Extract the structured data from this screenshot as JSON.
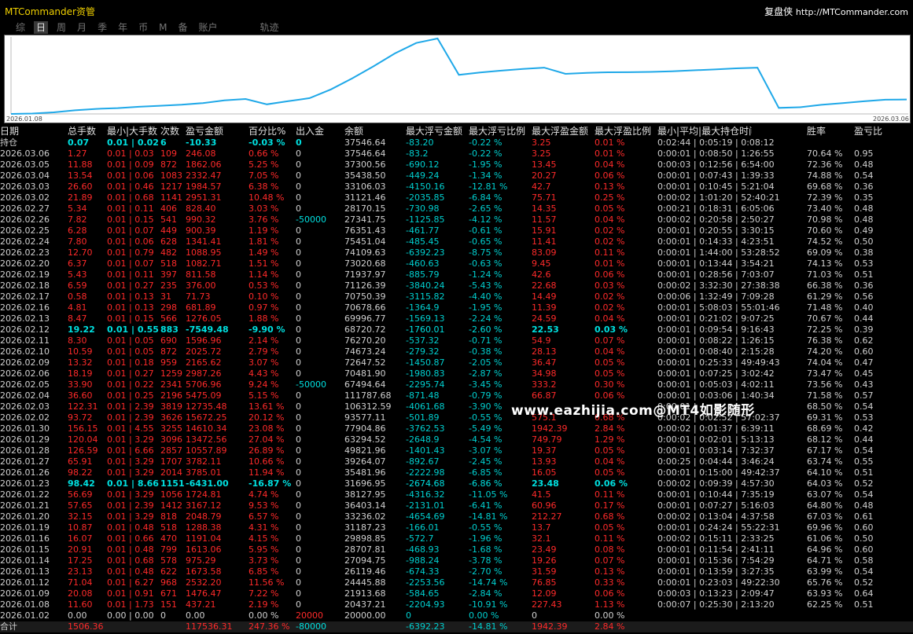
{
  "app": {
    "title": "MTCommander资管",
    "brand": "复盘侠",
    "url": "http://MTCommander.com"
  },
  "tabs": [
    {
      "label": "综",
      "active": false
    },
    {
      "label": "日",
      "active": true
    },
    {
      "label": "周",
      "active": false
    },
    {
      "label": "月",
      "active": false
    },
    {
      "label": "季",
      "active": false
    },
    {
      "label": "年",
      "active": false
    },
    {
      "label": "币",
      "active": false
    },
    {
      "label": "M",
      "active": false
    },
    {
      "label": "备",
      "active": false
    },
    {
      "label": "账户",
      "active": false
    },
    {
      "label": "轨迹",
      "active": false
    }
  ],
  "chart_data": {
    "type": "line",
    "x_start": "2026.01.08",
    "x_end": "2026.03.06",
    "series": [
      {
        "color": "#1fa8e8",
        "values": [
          20000,
          20437.21,
          21913.68,
          24445.88,
          26119.46,
          27094.75,
          28707.81,
          29898.85,
          31187.23,
          33236.02,
          36403.14,
          38127.95,
          31696.95,
          35481.96,
          39264.07,
          49821.96,
          63294.52,
          77904.86,
          93577.11,
          106312.59,
          111787.68,
          67494.64,
          70481.9,
          72647.52,
          74673.24,
          76270.2,
          68720.72,
          69996.77,
          70678.66,
          70750.39,
          71126.39,
          71937.97,
          73020.68,
          74109.63,
          75451.04,
          76351.43,
          27341.75,
          28170.15,
          31121.46,
          33106.03,
          35438.5,
          37300.56,
          37546.64
        ]
      }
    ]
  },
  "watermark": "www.eazhijia.com@MT4如影随形",
  "table": {
    "headers": [
      "日期",
      "总手数",
      "最小|大手数",
      "次数",
      "盈亏金额",
      "百分比%",
      "出入金",
      "余额",
      "最大浮亏金额",
      "最大浮亏比例",
      "最大浮盈金额",
      "最大浮盈比例",
      "最小|平均|最大持仓时间",
      "",
      "胜率",
      "盈亏比"
    ],
    "position": {
      "label": "持仓",
      "lots": "0.07",
      "minmax": "0.01 | 0.02",
      "count": "6",
      "profit": "-10.33",
      "pct": "-0.03 %",
      "flow": "0",
      "balance": "37546.64",
      "fl_amt": "-83.20",
      "fl_pct": "-0.22 %",
      "fp_amt": "3.25",
      "fp_pct": "0.01 %",
      "time": "0:02:44 | 0:05:19 | 0:08:12",
      "win": "",
      "pf": ""
    },
    "rows": [
      [
        "2026.03.06",
        "1.27",
        "0.01 | 0.03",
        "109",
        "246.08",
        "0.66 %",
        "0",
        "37546.64",
        "-83.2",
        "-0.22 %",
        "3.25",
        "0.01 %",
        "0:00:01 | 0:08:50 | 1:26:55",
        "70.64 %",
        "0.95"
      ],
      [
        "2026.03.05",
        "11.88",
        "0.01 | 0.09",
        "872",
        "1862.06",
        "5.25 %",
        "0",
        "37300.56",
        "-690.12",
        "-1.95 %",
        "13.45",
        "0.04 %",
        "0:00:03 | 0:12:56 | 6:54:00",
        "72.36 %",
        "0.48"
      ],
      [
        "2026.03.04",
        "13.54",
        "0.01 | 0.06",
        "1083",
        "2332.47",
        "7.05 %",
        "0",
        "35438.50",
        "-449.24",
        "-1.34 %",
        "20.27",
        "0.06 %",
        "0:00:01 | 0:07:43 | 1:39:33",
        "74.88 %",
        "0.54"
      ],
      [
        "2026.03.03",
        "26.60",
        "0.01 | 0.46",
        "1217",
        "1984.57",
        "6.38 %",
        "0",
        "33106.03",
        "-4150.16",
        "-12.81 %",
        "42.7",
        "0.13 %",
        "0:00:01 | 0:10:45 | 5:21:04",
        "69.68 %",
        "0.36"
      ],
      [
        "2026.03.02",
        "21.89",
        "0.01 | 0.68",
        "1141",
        "2951.31",
        "10.48 %",
        "0",
        "31121.46",
        "-2035.85",
        "-6.84 %",
        "75.71",
        "0.25 %",
        "0:00:02 | 1:01:20 | 52:40:21",
        "72.39 %",
        "0.35"
      ],
      [
        "2026.02.27",
        "5.34",
        "0.01 | 0.11",
        "406",
        "828.40",
        "3.03 %",
        "0",
        "28170.15",
        "-730.98",
        "-2.65 %",
        "14.35",
        "0.05 %",
        "0:00:21 | 0:18:31 | 6:05:06",
        "73.40 %",
        "0.48"
      ],
      [
        "2026.02.26",
        "7.82",
        "0.01 | 0.15",
        "541",
        "990.32",
        "3.76 %",
        "-50000",
        "27341.75",
        "-1125.85",
        "-4.12 %",
        "11.57",
        "0.04 %",
        "0:00:02 | 0:20:58 | 2:50:27",
        "70.98 %",
        "0.48"
      ],
      [
        "2026.02.25",
        "6.28",
        "0.01 | 0.07",
        "449",
        "900.39",
        "1.19 %",
        "0",
        "76351.43",
        "-461.77",
        "-0.61 %",
        "15.91",
        "0.02 %",
        "0:00:01 | 0:20:55 | 3:30:15",
        "70.60 %",
        "0.49"
      ],
      [
        "2026.02.24",
        "7.80",
        "0.01 | 0.06",
        "628",
        "1341.41",
        "1.81 %",
        "0",
        "75451.04",
        "-485.45",
        "-0.65 %",
        "11.41",
        "0.02 %",
        "0:00:01 | 0:14:33 | 4:23:51",
        "74.52 %",
        "0.50"
      ],
      [
        "2026.02.23",
        "12.70",
        "0.01 | 0.79",
        "482",
        "1088.95",
        "1.49 %",
        "0",
        "74109.63",
        "-6392.23",
        "-8.75 %",
        "83.09",
        "0.11 %",
        "0:00:01 | 1:44:00 | 53:28:52",
        "69.09 %",
        "0.38"
      ],
      [
        "2026.02.20",
        "6.37",
        "0.01 | 0.07",
        "518",
        "1082.71",
        "1.51 %",
        "0",
        "73020.68",
        "-460.63",
        "-0.63 %",
        "9.45",
        "0.01 %",
        "0:00:01 | 0:13:44 | 3:54:21",
        "74.13 %",
        "0.53"
      ],
      [
        "2026.02.19",
        "5.43",
        "0.01 | 0.11",
        "397",
        "811.58",
        "1.14 %",
        "0",
        "71937.97",
        "-885.79",
        "-1.24 %",
        "42.6",
        "0.06 %",
        "0:00:01 | 0:28:56 | 7:03:07",
        "71.03 %",
        "0.51"
      ],
      [
        "2026.02.18",
        "6.59",
        "0.01 | 0.27",
        "235",
        "376.00",
        "0.53 %",
        "0",
        "71126.39",
        "-3840.24",
        "-5.43 %",
        "22.68",
        "0.03 %",
        "0:00:02 | 3:32:30 | 27:38:38",
        "66.38 %",
        "0.36"
      ],
      [
        "2026.02.17",
        "0.58",
        "0.01 | 0.13",
        "31",
        "71.73",
        "0.10 %",
        "0",
        "70750.39",
        "-3115.82",
        "-4.40 %",
        "14.49",
        "0.02 %",
        "0:00:06 | 1:32:49 | 7:09:28",
        "61.29 %",
        "0.56"
      ],
      [
        "2026.02.16",
        "4.81",
        "0.01 | 0.13",
        "298",
        "681.89",
        "0.97 %",
        "0",
        "70678.66",
        "-1364.9",
        "-1.95 %",
        "11.39",
        "0.02 %",
        "0:00:01 | 5:08:03 | 55:01:46",
        "71.48 %",
        "0.40"
      ],
      [
        "2026.02.13",
        "8.47",
        "0.01 | 0.15",
        "566",
        "1276.05",
        "1.88 %",
        "0",
        "69996.77",
        "-1569.13",
        "-2.24 %",
        "24.59",
        "0.04 %",
        "0:00:01 | 0:21:02 | 9:07:25",
        "70.67 %",
        "0.44"
      ],
      [
        "2026.02.12",
        "19.22",
        "0.01 | 0.55",
        "883",
        "-7549.48",
        "-9.90 %",
        "0",
        "68720.72",
        "-1760.01",
        "-2.60 %",
        "22.53",
        "0.03 %",
        "0:00:01 | 0:09:54 | 9:16:43",
        "72.25 %",
        "0.39"
      ],
      [
        "2026.02.11",
        "8.30",
        "0.01 | 0.05",
        "690",
        "1596.96",
        "2.14 %",
        "0",
        "76270.20",
        "-537.32",
        "-0.71 %",
        "54.9",
        "0.07 %",
        "0:00:01 | 0:08:22 | 1:26:15",
        "76.38 %",
        "0.62"
      ],
      [
        "2026.02.10",
        "10.59",
        "0.01 | 0.05",
        "872",
        "2025.72",
        "2.79 %",
        "0",
        "74673.24",
        "-279.32",
        "-0.38 %",
        "28.13",
        "0.04 %",
        "0:00:01 | 0:08:40 | 2:15:28",
        "74.20 %",
        "0.60"
      ],
      [
        "2026.02.09",
        "13.32",
        "0.01 | 0.18",
        "959",
        "2165.62",
        "3.07 %",
        "0",
        "72647.52",
        "-1450.87",
        "-2.05 %",
        "36.47",
        "0.05 %",
        "0:00:01 | 0:25:33 | 49:49:43",
        "74.04 %",
        "0.47"
      ],
      [
        "2026.02.06",
        "18.19",
        "0.01 | 0.27",
        "1259",
        "2987.26",
        "4.43 %",
        "0",
        "70481.90",
        "-1980.83",
        "-2.87 %",
        "34.98",
        "0.05 %",
        "0:00:01 | 0:07:25 | 3:02:42",
        "73.47 %",
        "0.45"
      ],
      [
        "2026.02.05",
        "33.90",
        "0.01 | 0.22",
        "2341",
        "5706.96",
        "9.24 %",
        "-50000",
        "67494.64",
        "-2295.74",
        "-3.45 %",
        "333.2",
        "0.30 %",
        "0:00:01 | 0:05:03 | 4:02:11",
        "73.56 %",
        "0.43"
      ],
      [
        "2026.02.04",
        "36.60",
        "0.01 | 0.25",
        "2196",
        "5475.09",
        "5.15 %",
        "0",
        "111787.68",
        "-871.48",
        "-0.79 %",
        "66.87",
        "0.06 %",
        "0:00:01 | 0:03:06 | 1:40:34",
        "71.58 %",
        "0.57"
      ],
      [
        "2026.02.03",
        "122.31",
        "0.01 | 2.39",
        "3819",
        "12735.48",
        "13.61 %",
        "0",
        "106312.59",
        "-4061.68",
        "-3.90 %",
        "",
        "",
        "0:00:01 | ",
        "68.50 %",
        "0.54"
      ],
      [
        "2026.02.02",
        "93.72",
        "0.01 | 2.39",
        "3626",
        "15672.25",
        "20.12 %",
        "0",
        "93577.11",
        "-501.89",
        "-0.55 %",
        "575.1",
        "0.68 %",
        "0:00:02 | 0:02:52 | 57:02:37",
        "69.31 %",
        "0.53"
      ],
      [
        "2026.01.30",
        "156.15",
        "0.01 | 4.55",
        "3255",
        "14610.34",
        "23.08 %",
        "0",
        "77904.86",
        "-3762.53",
        "-5.49 %",
        "1942.39",
        "2.84 %",
        "0:00:02 | 0:01:37 | 6:39:11",
        "68.69 %",
        "0.42"
      ],
      [
        "2026.01.29",
        "120.04",
        "0.01 | 3.29",
        "3096",
        "13472.56",
        "27.04 %",
        "0",
        "63294.52",
        "-2648.9",
        "-4.54 %",
        "749.79",
        "1.29 %",
        "0:00:01 | 0:02:01 | 5:13:13",
        "68.12 %",
        "0.44"
      ],
      [
        "2026.01.28",
        "126.59",
        "0.01 | 6.66",
        "2857",
        "10557.89",
        "26.89 %",
        "0",
        "49821.96",
        "-1401.43",
        "-3.07 %",
        "19.37",
        "0.05 %",
        "0:00:01 | 0:03:14 | 7:32:37",
        "67.17 %",
        "0.54"
      ],
      [
        "2026.01.27",
        "65.91",
        "0.01 | 3.29",
        "1707",
        "3782.11",
        "10.66 %",
        "0",
        "39264.07",
        "-892.67",
        "-2.45 %",
        "13.93",
        "0.04 %",
        "0:00:25 | 0:04:44 | 3:46:24",
        "63.74 %",
        "0.55"
      ],
      [
        "2026.01.26",
        "98.22",
        "0.01 | 3.29",
        "2014",
        "3785.01",
        "11.94 %",
        "0",
        "35481.96",
        "-2222.98",
        "-6.85 %",
        "16.05",
        "0.05 %",
        "0:00:01 | 0:15:00 | 49:42:37",
        "64.10 %",
        "0.51"
      ],
      [
        "2026.01.23",
        "98.42",
        "0.01 | 8.66",
        "1151",
        "-6431.00",
        "-16.87 %",
        "0",
        "31696.95",
        "-2674.68",
        "-6.86 %",
        "23.48",
        "0.06 %",
        "0:00:02 | 0:09:39 | 4:57:30",
        "64.03 %",
        "0.52"
      ],
      [
        "2026.01.22",
        "56.69",
        "0.01 | 3.29",
        "1056",
        "1724.81",
        "4.74 %",
        "0",
        "38127.95",
        "-4316.32",
        "-11.05 %",
        "41.5",
        "0.11 %",
        "0:00:01 | 0:10:44 | 7:35:19",
        "63.07 %",
        "0.54"
      ],
      [
        "2026.01.21",
        "57.65",
        "0.01 | 2.39",
        "1412",
        "3167.12",
        "9.53 %",
        "0",
        "36403.14",
        "-2131.01",
        "-6.41 %",
        "60.96",
        "0.17 %",
        "0:00:01 | 0:07:27 | 5:16:03",
        "64.80 %",
        "0.48"
      ],
      [
        "2026.01.20",
        "32.15",
        "0.01 | 3.29",
        "818",
        "2048.79",
        "6.57 %",
        "0",
        "33236.02",
        "-4654.69",
        "-14.81 %",
        "212.27",
        "0.68 %",
        "0:00:02 | 0:13:04 | 4:37:58",
        "67.03 %",
        "0.61"
      ],
      [
        "2026.01.19",
        "10.87",
        "0.01 | 0.48",
        "518",
        "1288.38",
        "4.31 %",
        "0",
        "31187.23",
        "-166.01",
        "-0.55 %",
        "13.7",
        "0.05 %",
        "0:00:01 | 0:24:24 | 55:22:31",
        "69.96 %",
        "0.60"
      ],
      [
        "2026.01.16",
        "16.07",
        "0.01 | 0.66",
        "470",
        "1191.04",
        "4.15 %",
        "0",
        "29898.85",
        "-572.7",
        "-1.96 %",
        "32.1",
        "0.11 %",
        "0:00:02 | 0:15:11 | 2:33:25",
        "61.06 %",
        "0.50"
      ],
      [
        "2026.01.15",
        "20.91",
        "0.01 | 0.48",
        "799",
        "1613.06",
        "5.95 %",
        "0",
        "28707.81",
        "-468.93",
        "-1.68 %",
        "23.49",
        "0.08 %",
        "0:00:01 | 0:11:54 | 2:41:11",
        "64.96 %",
        "0.60"
      ],
      [
        "2026.01.14",
        "17.25",
        "0.01 | 0.68",
        "578",
        "975.29",
        "3.73 %",
        "0",
        "27094.75",
        "-988.24",
        "-3.78 %",
        "19.26",
        "0.07 %",
        "0:00:01 | 0:15:36 | 7:54:29",
        "64.71 %",
        "0.58"
      ],
      [
        "2026.01.13",
        "23.13",
        "0.01 | 0.48",
        "622",
        "1673.58",
        "6.85 %",
        "0",
        "26119.46",
        "-674.33",
        "-2.70 %",
        "31.59",
        "0.13 %",
        "0:00:01 | 0:13:59 | 3:27:35",
        "63.99 %",
        "0.54"
      ],
      [
        "2026.01.12",
        "71.04",
        "0.01 | 6.27",
        "968",
        "2532.20",
        "11.56 %",
        "0",
        "24445.88",
        "-2253.56",
        "-14.74 %",
        "76.85",
        "0.33 %",
        "0:00:01 | 0:23:03 | 49:22:30",
        "65.76 %",
        "0.52"
      ],
      [
        "2026.01.09",
        "20.08",
        "0.01 | 0.91",
        "671",
        "1476.47",
        "7.22 %",
        "0",
        "21913.68",
        "-584.65",
        "-2.84 %",
        "12.09",
        "0.06 %",
        "0:00:03 | 0:13:23 | 2:09:47",
        "63.93 %",
        "0.64"
      ],
      [
        "2026.01.08",
        "11.60",
        "0.01 | 1.73",
        "151",
        "437.21",
        "2.19 %",
        "0",
        "20437.21",
        "-2204.93",
        "-10.91 %",
        "227.43",
        "1.13 %",
        "0:00:07 | 0:25:30 | 2:13:20",
        "62.25 %",
        "0.51"
      ],
      [
        "2026.01.02",
        "0.00",
        "0.00 | 0.00",
        "0",
        "0.00",
        "0.00 %",
        "20000",
        "20000.00",
        "0",
        "0.00 %",
        "0",
        "0.00 %",
        "",
        "",
        ""
      ]
    ],
    "total": {
      "label": "合计",
      "lots": "1506.36",
      "minmax": "",
      "count": "",
      "profit": "117536.31",
      "pct": "247.36 %",
      "flow": "-80000",
      "balance": "",
      "fl_amt": "-6392.23",
      "fl_pct": "-14.81 %",
      "fp_amt": "1942.39",
      "fp_pct": "2.84 %"
    }
  }
}
